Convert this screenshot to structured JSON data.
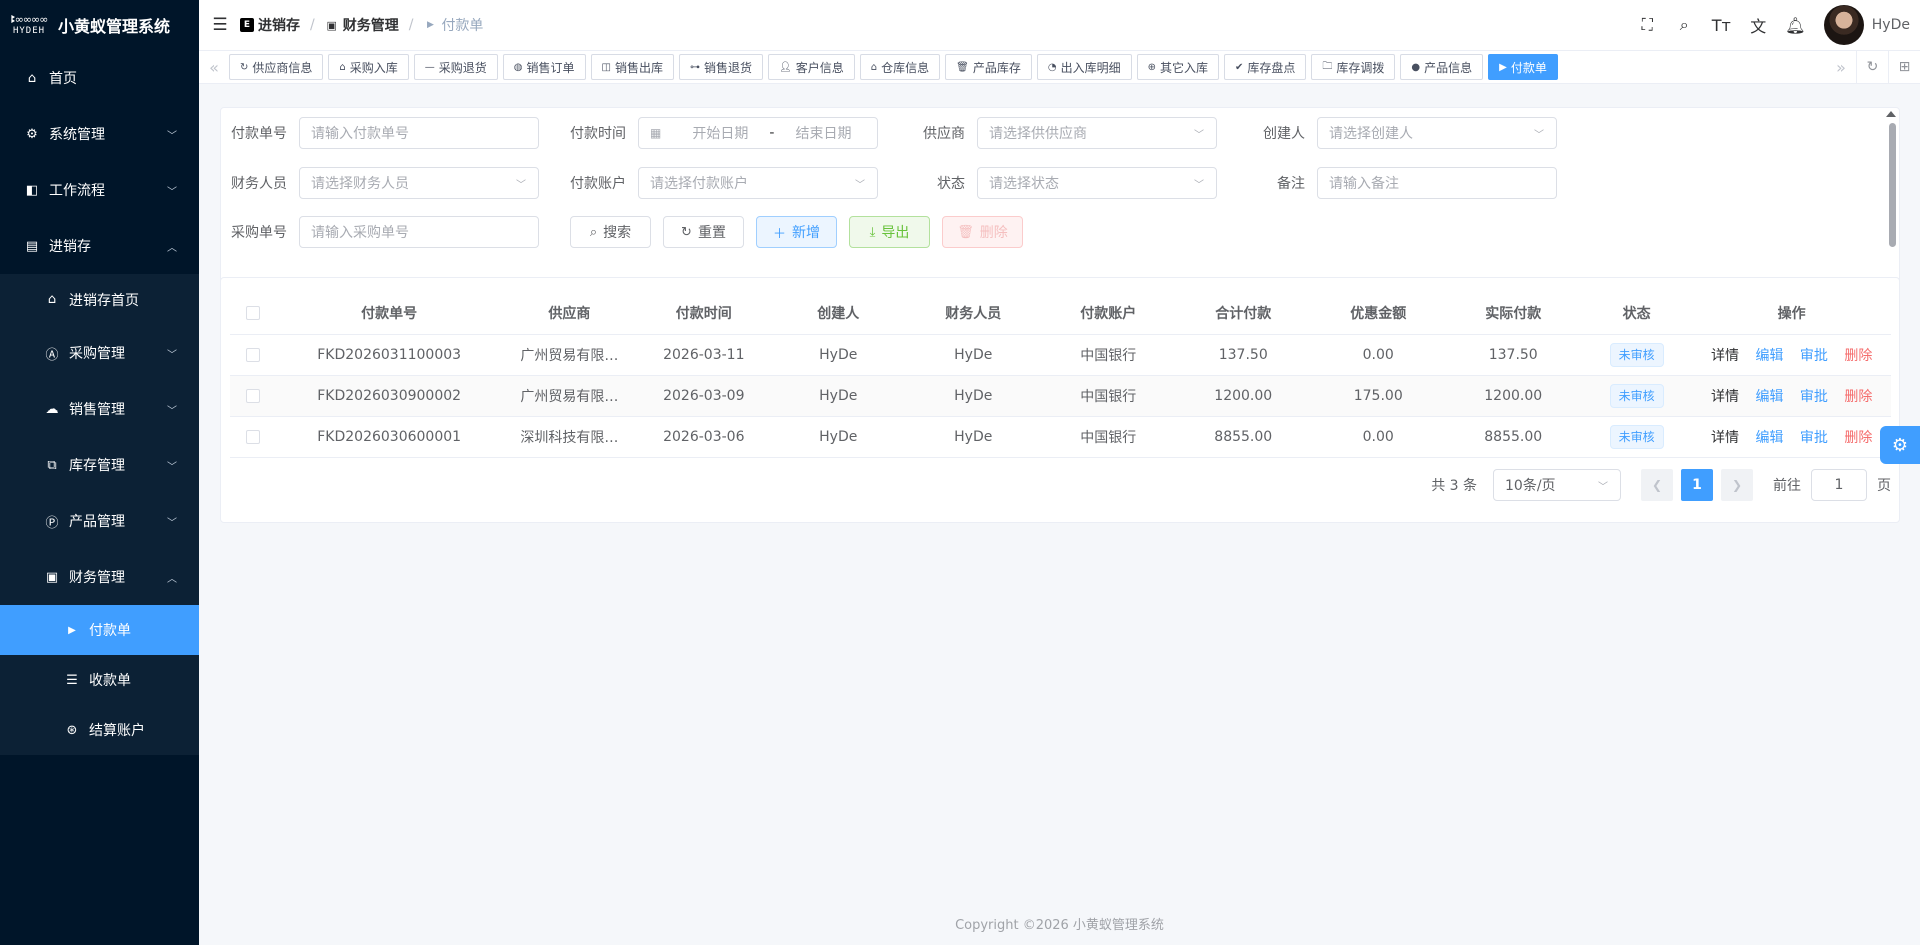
{
  "app": {
    "logo_mark_text": "HYDEH",
    "title": "小黄蚁管理系统"
  },
  "sidebar": {
    "items": [
      {
        "label": "首页",
        "icon": "home-icon"
      },
      {
        "label": "系统管理",
        "icon": "gear-icon"
      },
      {
        "label": "工作流程",
        "icon": "workflow-icon"
      },
      {
        "label": "进销存",
        "icon": "inventory-icon"
      }
    ],
    "inventory_children": [
      {
        "label": "进销存首页",
        "icon": "home-icon"
      },
      {
        "label": "采购管理",
        "icon": "purchase-icon"
      },
      {
        "label": "销售管理",
        "icon": "cloud-icon"
      },
      {
        "label": "库存管理",
        "icon": "stock-icon"
      },
      {
        "label": "产品管理",
        "icon": "product-icon"
      },
      {
        "label": "财务管理",
        "icon": "finance-icon"
      }
    ],
    "finance_children": [
      {
        "label": "付款单",
        "icon": "triangle-right-icon",
        "active": true
      },
      {
        "label": "收款单",
        "icon": "list-icon"
      },
      {
        "label": "结算账户",
        "icon": "account-icon"
      }
    ]
  },
  "header": {
    "breadcrumb": [
      "进销存",
      "财务管理",
      "付款单"
    ],
    "user_name": "HyDe"
  },
  "tags": [
    "供应商信息",
    "采购入库",
    "采购退货",
    "销售订单",
    "销售出库",
    "销售退货",
    "客户信息",
    "仓库信息",
    "产品库存",
    "出入库明细",
    "其它入库",
    "库存盘点",
    "库存调拨",
    "产品信息",
    "付款单"
  ],
  "search": {
    "payment_no": {
      "label": "付款单号",
      "placeholder": "请输入付款单号"
    },
    "payment_time": {
      "label": "付款时间",
      "start": "开始日期",
      "sep": "-",
      "end": "结束日期"
    },
    "supplier": {
      "label": "供应商",
      "placeholder": "请选择供供应商"
    },
    "creator": {
      "label": "创建人",
      "placeholder": "请选择创建人"
    },
    "finance_person": {
      "label": "财务人员",
      "placeholder": "请选择财务人员"
    },
    "account": {
      "label": "付款账户",
      "placeholder": "请选择付款账户"
    },
    "status": {
      "label": "状态",
      "placeholder": "请选择状态"
    },
    "remark": {
      "label": "备注",
      "placeholder": "请输入备注"
    },
    "purchase_no": {
      "label": "采购单号",
      "placeholder": "请输入采购单号"
    },
    "buttons": {
      "search": "搜索",
      "reset": "重置",
      "add": "新增",
      "export": "导出",
      "delete": "删除"
    }
  },
  "table": {
    "columns": [
      "付款单号",
      "供应商",
      "付款时间",
      "创建人",
      "财务人员",
      "付款账户",
      "合计付款",
      "优惠金额",
      "实际付款",
      "状态",
      "操作"
    ],
    "rows": [
      {
        "no": "FKD2026031100003",
        "supplier": "广州贸易有限…",
        "time": "2026-03-11",
        "creator": "HyDe",
        "finance": "HyDe",
        "account": "中国银行",
        "total": "137.50",
        "discount": "0.00",
        "actual": "137.50",
        "status": "未审核"
      },
      {
        "no": "FKD2026030900002",
        "supplier": "广州贸易有限…",
        "time": "2026-03-09",
        "creator": "HyDe",
        "finance": "HyDe",
        "account": "中国银行",
        "total": "1200.00",
        "discount": "175.00",
        "actual": "1200.00",
        "status": "未审核"
      },
      {
        "no": "FKD2026030600001",
        "supplier": "深圳科技有限…",
        "time": "2026-03-06",
        "creator": "HyDe",
        "finance": "HyDe",
        "account": "中国银行",
        "total": "8855.00",
        "discount": "0.00",
        "actual": "8855.00",
        "status": "未审核"
      }
    ],
    "actions": {
      "detail": "详情",
      "edit": "编辑",
      "approve": "审批",
      "delete": "删除"
    }
  },
  "pagination": {
    "total": "共 3 条",
    "page_size": "10条/页",
    "current": "1",
    "jump_prefix": "前往",
    "jump_value": "1",
    "jump_suffix": "页"
  },
  "footer": {
    "copyright": "Copyright ©2026 小黄蚁管理系统"
  },
  "colors": {
    "primary": "#409eff",
    "sidebar_bg": "#001529",
    "danger": "#f56c6c",
    "success": "#67c23a"
  }
}
